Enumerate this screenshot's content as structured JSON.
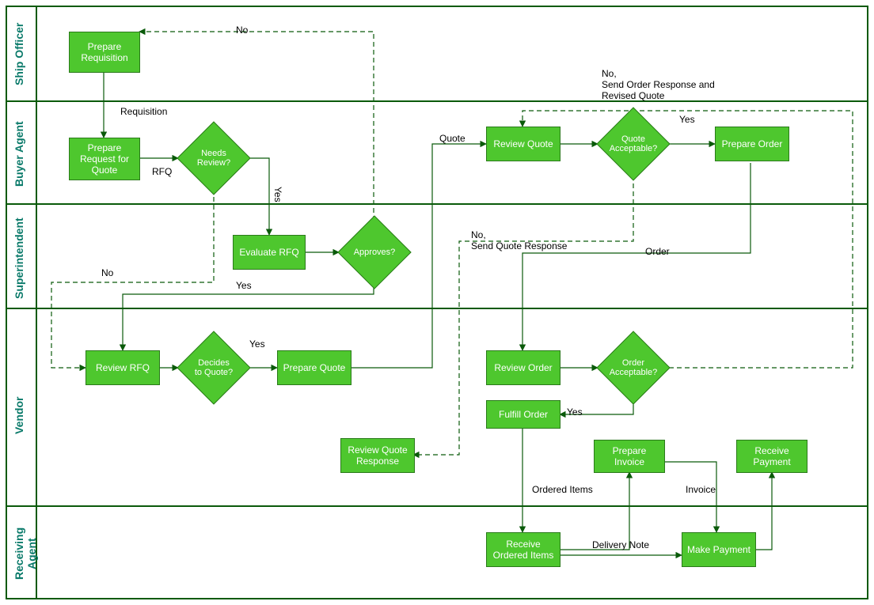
{
  "lanes": {
    "shipOfficer": "Ship Officer",
    "buyerAgent": "Buyer Agent",
    "superintendent": "Superintendent",
    "vendor": "Vendor",
    "receivingAgent": "Receiving Agent"
  },
  "boxes": {
    "prepareRequisition": "Prepare\nRequisition",
    "prepareRFQ": "Prepare\nRequest for\nQuote",
    "needsReview": "Needs\nReview?",
    "evaluateRFQ": "Evaluate RFQ",
    "approves": "Approves?",
    "reviewRFQ": "Review RFQ",
    "decidesQuote": "Decides\nto Quote?",
    "prepareQuote": "Prepare Quote",
    "reviewQuoteResponse": "Review Quote\nResponse",
    "reviewQuote": "Review Quote",
    "quoteAcceptable": "Quote\nAcceptable?",
    "prepareOrder": "Prepare Order",
    "reviewOrder": "Review Order",
    "orderAcceptable": "Order\nAcceptable?",
    "fulfillOrder": "Fulfill Order",
    "prepareInvoice": "Prepare\nInvoice",
    "receivePayment": "Receive\nPayment",
    "receiveOrdered": "Receive\nOrdered Items",
    "makePayment": "Make Payment"
  },
  "labels": {
    "requisition": "Requisition",
    "rfq": "RFQ",
    "no": "No",
    "yes": "Yes",
    "noNewline": "No,\nSend Order Response and\nRevised Quote",
    "quote": "Quote",
    "noSendQuote": "No,\nSend Quote Response",
    "order": "Order",
    "orderedItems": "Ordered Items",
    "deliveryNote": "Delivery Note",
    "invoice": "Invoice"
  }
}
